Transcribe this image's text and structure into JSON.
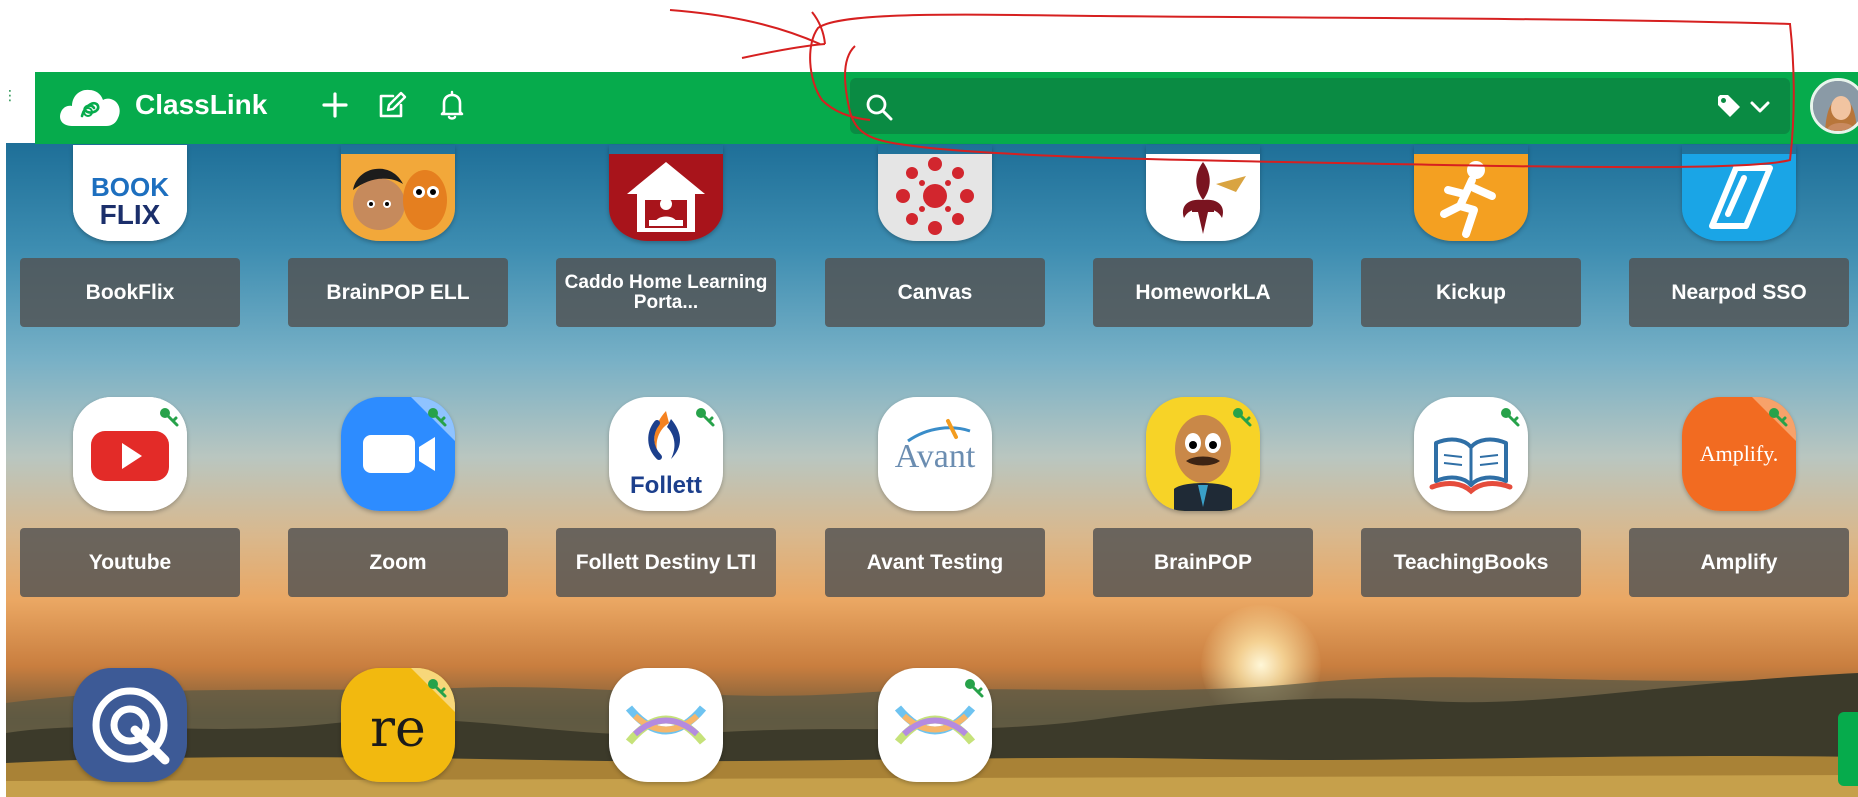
{
  "header": {
    "brand": "ClassLink",
    "search_placeholder": "",
    "colors": {
      "brand_green": "#06ab4c",
      "search_bg": "#0a8b43"
    }
  },
  "toolbar": {
    "icons": [
      "plus-icon",
      "edit-note-icon",
      "bell-icon"
    ]
  },
  "search": {
    "icons": [
      "search-icon",
      "tag-icon",
      "chevron-down-icon"
    ]
  },
  "apps": [
    {
      "label": "BookFlix",
      "icon": "bookflix-icon"
    },
    {
      "label": "BrainPOP ELL",
      "icon": "brainpop-ell-icon"
    },
    {
      "label": "Caddo Home Learning Porta...",
      "icon": "caddo-home-icon"
    },
    {
      "label": "Canvas",
      "icon": "canvas-icon"
    },
    {
      "label": "HomeworkLA",
      "icon": "homeworkla-icon"
    },
    {
      "label": "Kickup",
      "icon": "kickup-icon"
    },
    {
      "label": "Nearpod SSO",
      "icon": "nearpod-icon"
    },
    {
      "label": "Youtube",
      "icon": "youtube-icon"
    },
    {
      "label": "Zoom",
      "icon": "zoom-icon"
    },
    {
      "label": "Follett Destiny LTI",
      "icon": "follett-icon"
    },
    {
      "label": "Avant Testing",
      "icon": "avant-icon"
    },
    {
      "label": "BrainPOP",
      "icon": "brainpop-icon"
    },
    {
      "label": "TeachingBooks",
      "icon": "teachingbooks-icon"
    },
    {
      "label": "Amplify",
      "icon": "amplify-icon"
    }
  ],
  "app_icon_text": {
    "bookflix_top": "BOOK",
    "bookflix_bottom": "FLIX",
    "follett": "Follett",
    "avant": "Avant",
    "amplify": "Amplify.",
    "re": "re"
  }
}
